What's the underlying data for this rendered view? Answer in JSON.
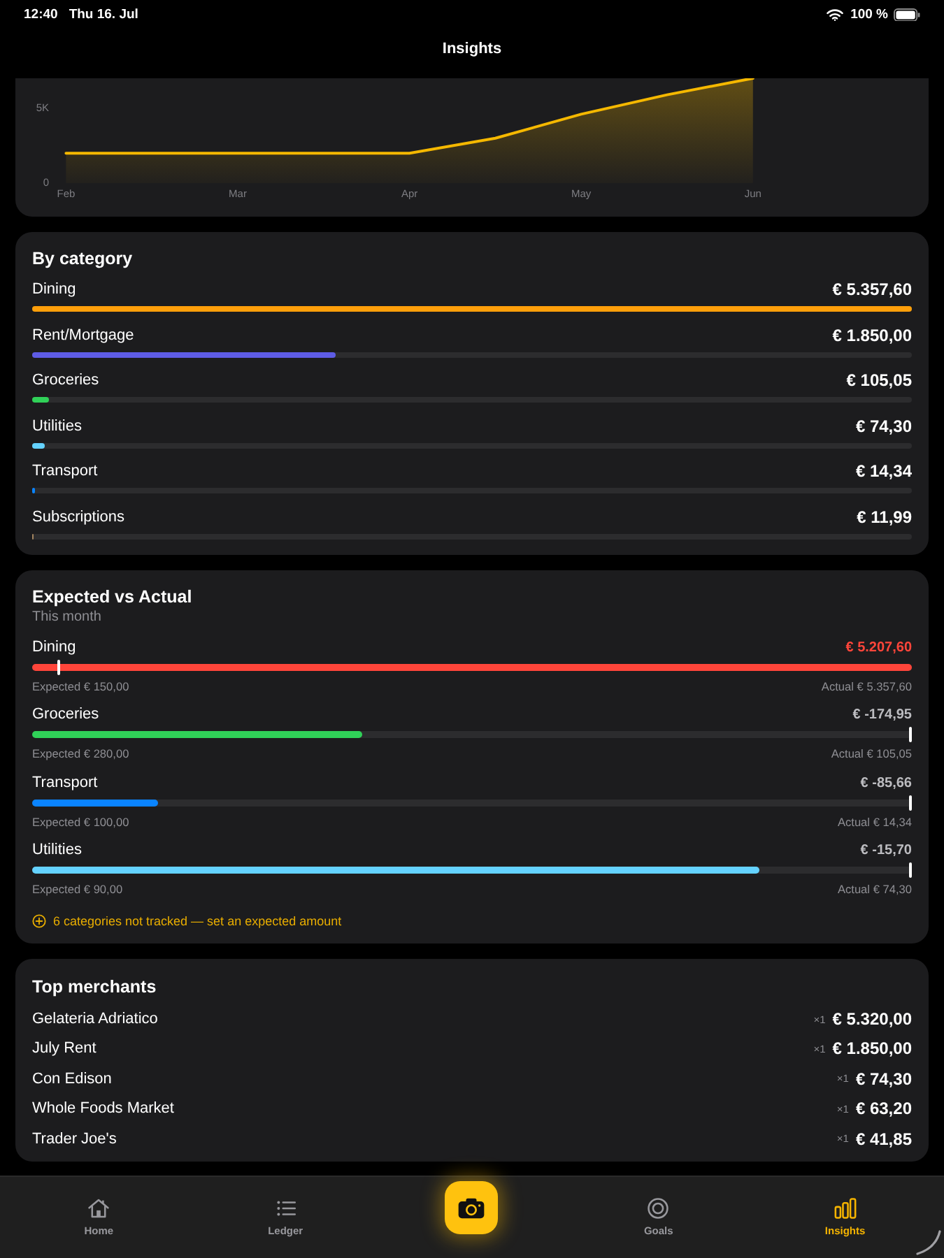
{
  "status_bar": {
    "time": "12:40",
    "date": "Thu 16. Jul",
    "battery": "100 %"
  },
  "navigation": {
    "title": "Insights"
  },
  "trend_card": {
    "chart_data": {
      "type": "area",
      "categories": [
        "Feb",
        null,
        "Mar",
        null,
        "Apr",
        null,
        "May",
        null,
        "Jun"
      ],
      "series": [
        {
          "color": "#f5b800",
          "values": [
            2000,
            2000,
            2000,
            2000,
            2000,
            3000,
            4600,
            5900,
            7000
          ]
        }
      ],
      "ylim": [
        0,
        7000
      ],
      "yticks": [
        0,
        {
          "value": 5000,
          "label": "5K"
        }
      ]
    }
  },
  "by_category": {
    "title": "By category",
    "rows": [
      {
        "name": "Dining",
        "amount": "€ 5.357,60",
        "level": 1,
        "color": "#ff9f0a"
      },
      {
        "name": "Rent/Mortgage",
        "amount": "€ 1.850,00",
        "level": 0.345,
        "color": "#5e5ce6"
      },
      {
        "name": "Groceries",
        "amount": "€ 105,05",
        "level": 0.0196,
        "color": "#30d158"
      },
      {
        "name": "Utilities",
        "amount": "€ 74,30",
        "level": 0.0139,
        "color": "#64d2ff"
      },
      {
        "name": "Transport",
        "amount": "€ 14,34",
        "level": 0.0027,
        "color": "#0a84ff"
      },
      {
        "name": "Subscriptions",
        "amount": "€ 11,99",
        "level": 0.0022,
        "color": "#a2845e"
      }
    ]
  },
  "expected_vs_actual": {
    "title": "Expected vs Actual",
    "subtitle": "This month",
    "rows": [
      {
        "name": "Dining",
        "difference": "€ 5.207,60",
        "over": true,
        "level": 1,
        "color": "#ff453a",
        "expected_marker": {
          "level": 0.028
        },
        "expected": "Expected € 150,00",
        "actual": "Actual € 5.357,60"
      },
      {
        "name": "Groceries",
        "difference": "€ -174,95",
        "over": false,
        "level": 0.375,
        "color": "#30d158",
        "expected_marker": {
          "level": 1
        },
        "expected": "Expected € 280,00",
        "actual": "Actual € 105,05"
      },
      {
        "name": "Transport",
        "difference": "€ -85,66",
        "over": false,
        "level": 0.143,
        "color": "#0a84ff",
        "expected_marker": {
          "level": 1
        },
        "expected": "Expected € 100,00",
        "actual": "Actual € 14,34"
      },
      {
        "name": "Utilities",
        "difference": "€ -15,70",
        "over": false,
        "level": 0.826,
        "color": "#64d2ff",
        "expected_marker": {
          "level": 1
        },
        "expected": "Expected € 90,00",
        "actual": "Actual € 74,30"
      }
    ],
    "footer": "6 categories not tracked — set an expected amount"
  },
  "top_merchants": {
    "title": "Top merchants",
    "rows": [
      {
        "name": "Gelateria Adriatico",
        "count": "×1",
        "amount": "€ 5.320,00"
      },
      {
        "name": "July Rent",
        "count": "×1",
        "amount": "€ 1.850,00"
      },
      {
        "name": "Con Edison",
        "count": "×1",
        "amount": "€ 74,30"
      },
      {
        "name": "Whole Foods Market",
        "count": "×1",
        "amount": "€ 63,20"
      },
      {
        "name": "Trader Joe's",
        "count": "×1",
        "amount": "€ 41,85"
      }
    ]
  },
  "tab_bar": {
    "items": [
      {
        "kind": "tab",
        "label": "Home",
        "selected": false
      },
      {
        "kind": "tab",
        "label": "Ledger",
        "selected": false
      },
      {
        "kind": "action"
      },
      {
        "kind": "tab",
        "label": "Goals",
        "selected": false
      },
      {
        "kind": "tab",
        "label": "Insights",
        "selected": true
      }
    ]
  }
}
